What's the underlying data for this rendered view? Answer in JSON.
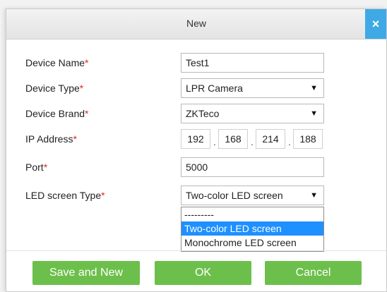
{
  "dialog": {
    "title": "New",
    "close_glyph": "×"
  },
  "form": {
    "device_name": {
      "label": "Device Name",
      "required": "*",
      "value": "Test1"
    },
    "device_type": {
      "label": "Device Type",
      "required": "*",
      "value": "LPR Camera",
      "arrow": "▼"
    },
    "device_brand": {
      "label": "Device Brand",
      "required": "*",
      "value": "ZKTeco",
      "arrow": "▼"
    },
    "ip_address": {
      "label": "IP Address",
      "required": "*",
      "octets": [
        "192",
        "168",
        "214",
        "188"
      ],
      "dot": "."
    },
    "port": {
      "label": "Port",
      "required": "*",
      "value": "5000"
    },
    "led_screen_type": {
      "label": "LED screen Type",
      "required": "*",
      "value": "Two-color LED screen",
      "arrow": "▼",
      "options": [
        "---------",
        "Two-color LED screen",
        "Monochrome LED screen"
      ],
      "highlighted_index": 1
    }
  },
  "buttons": {
    "save_new": "Save and New",
    "ok": "OK",
    "cancel": "Cancel"
  },
  "colors": {
    "accent": "#3fa9e6",
    "button_green": "#6cbf4b",
    "required": "#e0261f",
    "highlight": "#1e90ff"
  }
}
